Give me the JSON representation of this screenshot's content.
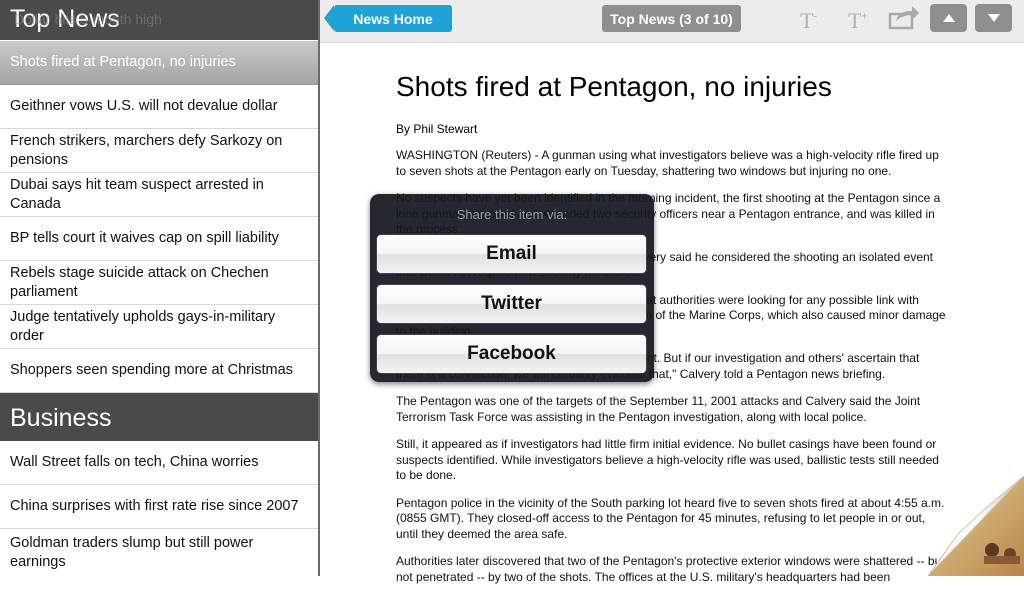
{
  "sidebar": {
    "top_header": "Top News",
    "hidden_item": "Dollar hits 5-month high",
    "top_items": [
      {
        "label": "Shots fired at Pentagon, no injuries",
        "selected": true
      },
      {
        "label": "Geithner vows U.S. will not devalue dollar"
      },
      {
        "label": "French strikers, marchers defy Sarkozy on pensions"
      },
      {
        "label": "Dubai says hit team suspect arrested in Canada"
      },
      {
        "label": "BP tells court it waives cap on spill liability"
      },
      {
        "label": "Rebels stage suicide attack on Chechen parliament"
      },
      {
        "label": "Judge tentatively upholds gays-in-military order"
      },
      {
        "label": "Shoppers seen spending more at Christmas"
      }
    ],
    "business_header": "Business",
    "business_items": [
      {
        "label": "Wall Street falls on tech, China worries"
      },
      {
        "label": "China surprises with first rate rise since 2007"
      },
      {
        "label": "Goldman traders slump but still power earnings"
      }
    ]
  },
  "header": {
    "news_home": "News Home",
    "page_indicator": "Top News (3 of 10)",
    "font_smaller_icon": "text-smaller-icon",
    "font_larger_icon": "text-larger-icon",
    "share_icon": "share-icon",
    "up_icon": "arrow-up-icon",
    "down_icon": "arrow-down-icon"
  },
  "article": {
    "title": "Shots fired at Pentagon, no injuries",
    "byline": "By Phil Stewart",
    "paragraphs": [
      "WASHINGTON (Reuters) - A gunman using what investigators believe was a high-velocity rifle fired up to seven shots at the Pentagon early on Tuesday, shattering two windows but injuring no one.",
      "No suspects have yet been identified in the morning incident, the first shooting at the Pentagon since a lone gunman attacked and wounded two security officers near a Pentagon entrance, and was killed in the process.",
      "Pentagon Force Protection Agency Steven Calvery said he considered the shooting an isolated event that would not require new security measures.",
      "He said the investigation was continuing and that authorities were looking for any possible link with shots fired at night recently by National Museum of the Marine Corps, which also caused minor damage to the building.",
      "\"We are not aware of any connection at this point. But if our investigation and others' ascertain that there is a connection, we will certainly evaluate that,\" Calvery told a Pentagon news briefing.",
      "The Pentagon was one of the targets of the September 11, 2001 attacks and Calvery said the Joint Terrorism Task Force was assisting in the Pentagon investigation, along with local police.",
      "Still, it appeared as if investigators had little firm initial evidence. No bullet casings have been found or suspects identified. While investigators believe a high-velocity rifle was used, ballistic tests still needed to be done.",
      "Pentagon police in the vicinity of the South parking lot heard five to seven shots fired at about 4:55 a.m. (0855 GMT). They closed-off access to the Pentagon for 45 minutes, refusing to let people in or out, until they deemed the area safe.",
      "Authorities later discovered that two of the Pentagon's protective exterior windows were shattered -- but not penetrated -- by two of the shots. The offices at the U.S. military's headquarters had been"
    ]
  },
  "share": {
    "prompt": "Share this item via:",
    "email": "Email",
    "twitter": "Twitter",
    "facebook": "Facebook"
  },
  "colors": {
    "accent": "#1fa3d6",
    "section_header": "#4a4a4a",
    "button_gray": "#8f8f8f"
  }
}
